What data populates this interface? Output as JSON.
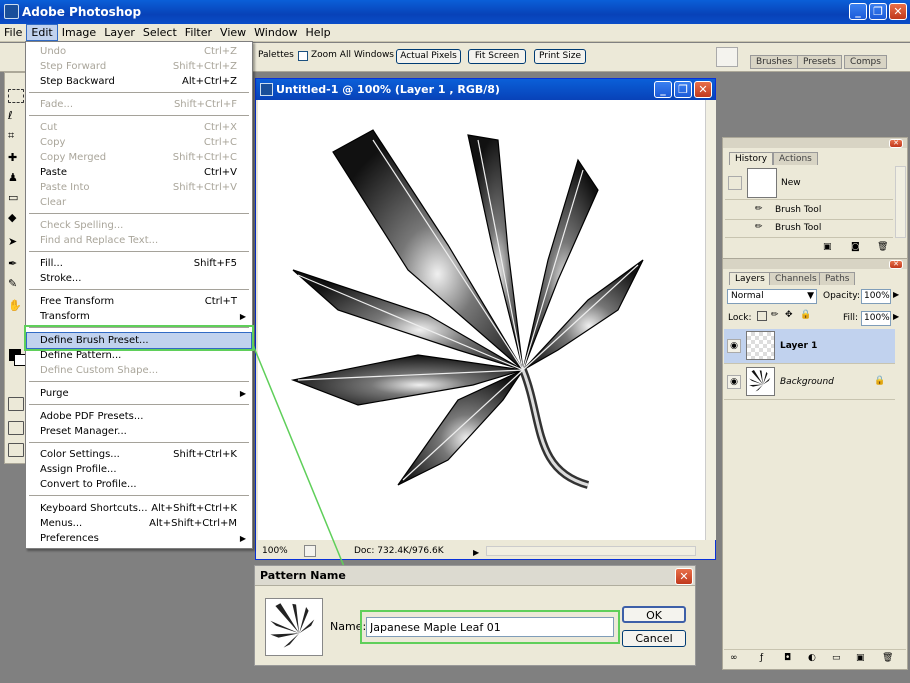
{
  "app": {
    "title": "Adobe Photoshop"
  },
  "menubar": {
    "items": [
      "File",
      "Edit",
      "Image",
      "Layer",
      "Select",
      "Filter",
      "View",
      "Window",
      "Help"
    ]
  },
  "options_bar": {
    "palettes_label": "Palettes",
    "zoom_all_windows": "Zoom All Windows",
    "actual_pixels": "Actual Pixels",
    "fit_screen": "Fit Screen",
    "print_size": "Print Size",
    "palette_tabs": [
      "Brushes",
      "Presets",
      "Comps"
    ]
  },
  "edit_menu": {
    "items": [
      {
        "label": "Undo",
        "shortcut": "Ctrl+Z",
        "disabled": true
      },
      {
        "label": "Step Forward",
        "shortcut": "Shift+Ctrl+Z",
        "disabled": true
      },
      {
        "label": "Step Backward",
        "shortcut": "Alt+Ctrl+Z",
        "disabled": false
      },
      {
        "label": "Fade...",
        "shortcut": "Shift+Ctrl+F",
        "disabled": true
      },
      {
        "label": "Cut",
        "shortcut": "Ctrl+X",
        "disabled": true
      },
      {
        "label": "Copy",
        "shortcut": "Ctrl+C",
        "disabled": true
      },
      {
        "label": "Copy Merged",
        "shortcut": "Shift+Ctrl+C",
        "disabled": true
      },
      {
        "label": "Paste",
        "shortcut": "Ctrl+V",
        "disabled": false
      },
      {
        "label": "Paste Into",
        "shortcut": "Shift+Ctrl+V",
        "disabled": true
      },
      {
        "label": "Clear",
        "shortcut": "",
        "disabled": true
      },
      {
        "label": "Check Spelling...",
        "shortcut": "",
        "disabled": true
      },
      {
        "label": "Find and Replace Text...",
        "shortcut": "",
        "disabled": true
      },
      {
        "label": "Fill...",
        "shortcut": "Shift+F5",
        "disabled": false
      },
      {
        "label": "Stroke...",
        "shortcut": "",
        "disabled": false
      },
      {
        "label": "Free Transform",
        "shortcut": "Ctrl+T",
        "disabled": false
      },
      {
        "label": "Transform",
        "shortcut": "",
        "disabled": false,
        "submenu": true
      },
      {
        "label": "Define Brush Preset...",
        "shortcut": "",
        "disabled": false,
        "highlighted": true
      },
      {
        "label": "Define Pattern...",
        "shortcut": "",
        "disabled": false
      },
      {
        "label": "Define Custom Shape...",
        "shortcut": "",
        "disabled": true
      },
      {
        "label": "Purge",
        "shortcut": "",
        "disabled": false,
        "submenu": true
      },
      {
        "label": "Adobe PDF Presets...",
        "shortcut": "",
        "disabled": false
      },
      {
        "label": "Preset Manager...",
        "shortcut": "",
        "disabled": false
      },
      {
        "label": "Color Settings...",
        "shortcut": "Shift+Ctrl+K",
        "disabled": false
      },
      {
        "label": "Assign Profile...",
        "shortcut": "",
        "disabled": false
      },
      {
        "label": "Convert to Profile...",
        "shortcut": "",
        "disabled": false
      },
      {
        "label": "Keyboard Shortcuts...",
        "shortcut": "Alt+Shift+Ctrl+K",
        "disabled": false
      },
      {
        "label": "Menus...",
        "shortcut": "Alt+Shift+Ctrl+M",
        "disabled": false
      },
      {
        "label": "Preferences",
        "shortcut": "",
        "disabled": false,
        "submenu": true
      }
    ]
  },
  "document": {
    "title": "Untitled-1 @ 100% (Layer 1 , RGB/8)",
    "zoom": "100%",
    "doc_info": "Doc: 732.4K/976.6K"
  },
  "pattern_dialog": {
    "title": "Pattern Name",
    "name_label": "Name:",
    "name_value": "Japanese Maple Leaf 01",
    "ok": "OK",
    "cancel": "Cancel"
  },
  "history_panel": {
    "tabs": [
      "History",
      "Actions"
    ],
    "snapshot": "New",
    "states": [
      "Brush Tool",
      "Brush Tool"
    ]
  },
  "layers_panel": {
    "tabs": [
      "Layers",
      "Channels",
      "Paths"
    ],
    "blend_mode": "Normal",
    "opacity_label": "Opacity:",
    "opacity": "100%",
    "lock_label": "Lock:",
    "fill_label": "Fill:",
    "fill": "100%",
    "layers": [
      {
        "name": "Layer 1",
        "selected": true
      },
      {
        "name": "Background",
        "selected": false
      }
    ]
  },
  "colors": {
    "xp_blue": "#0842b8",
    "menu_highlight": "#c1d2ee",
    "callout_green": "#5fcf5a"
  }
}
